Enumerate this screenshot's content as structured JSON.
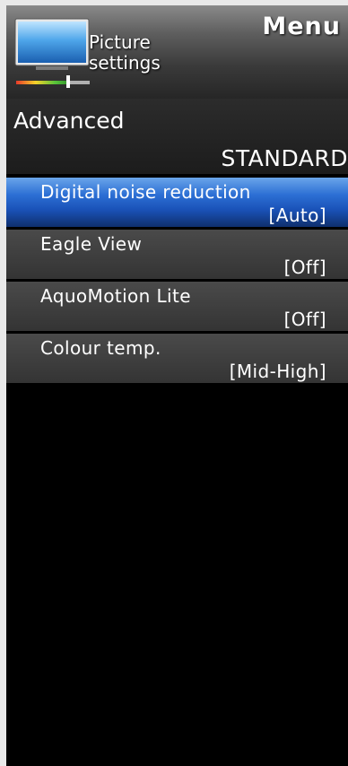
{
  "header": {
    "title": "Menu",
    "section_line1": "Picture",
    "section_line2": "settings",
    "icon": "tv-picture-icon"
  },
  "submenu": {
    "title": "Advanced",
    "mode": "STANDARD"
  },
  "items": [
    {
      "label": "Digital noise reduction",
      "value": "[Auto]",
      "selected": true
    },
    {
      "label": "Eagle View",
      "value": "[Off]",
      "selected": false
    },
    {
      "label": "AquoMotion Lite",
      "value": "[Off]",
      "selected": false
    },
    {
      "label": "Colour temp.",
      "value": "[Mid-High]",
      "selected": false
    }
  ],
  "colors": {
    "selection_blue": "#2c6fd4",
    "item_gray": "#404040",
    "background": "#000000",
    "page_border": "#e9e9e9"
  }
}
